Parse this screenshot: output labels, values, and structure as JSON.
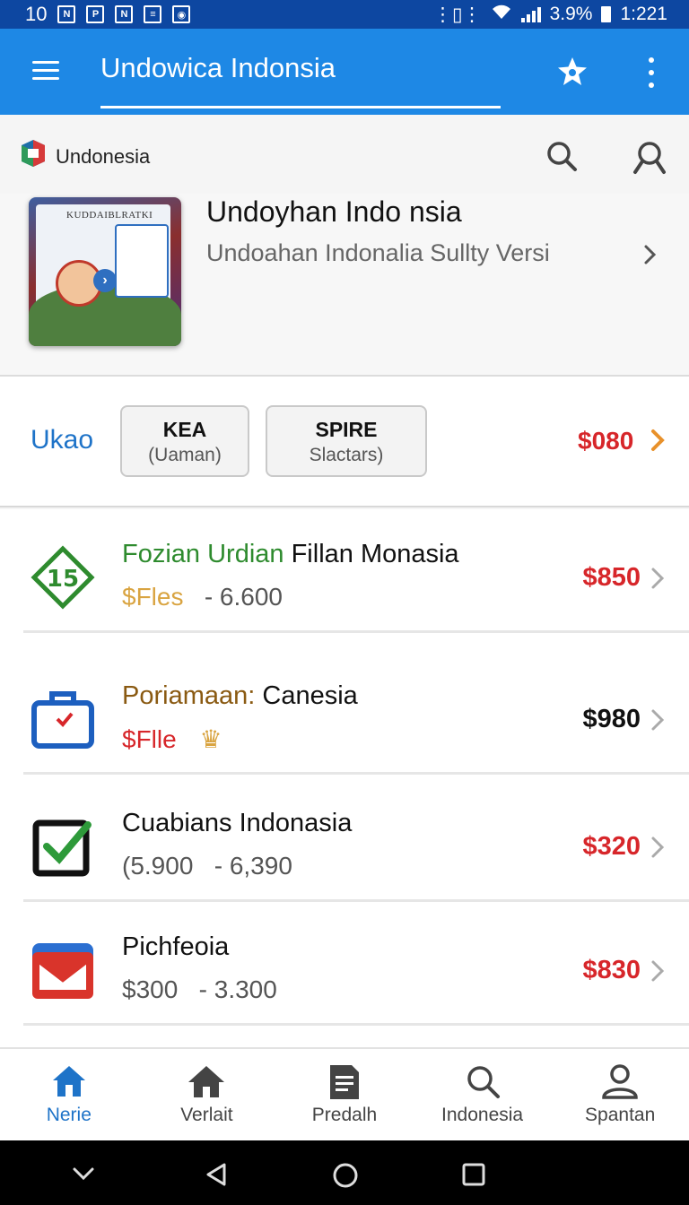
{
  "status_bar": {
    "time_left": "10",
    "battery": "3.9%",
    "clock": "1:221"
  },
  "app_bar": {
    "title": "Undowica Indonsia"
  },
  "brand": {
    "name": "Undonesia"
  },
  "featured": {
    "cover_text": "KUDDAIBLRATKI",
    "title": "Undoyhan Indo nsia",
    "subtitle": "Undoahan Indonalia Sullty Versi"
  },
  "filter": {
    "label": "Ukao",
    "chips": [
      {
        "title": "KEA",
        "sub": "(Uaman)"
      },
      {
        "title": "SPIRE",
        "sub": "Slactars)"
      }
    ],
    "price": "$080"
  },
  "list": [
    {
      "title_a": "Fozian Urdian",
      "title_b": "Fillan Monasia",
      "sub_a": "$Fles",
      "sub_b": "- 6.600",
      "price": "$850",
      "icon": "tag-icon"
    },
    {
      "title_a": "Poriamaan:",
      "title_b": "Canesia",
      "sub_a": "$Flle",
      "sub_b": "",
      "price": "$980",
      "icon": "briefcase-icon"
    },
    {
      "title_a": "",
      "title_b": "Cuabians Indonasia",
      "sub_a": "(5.900",
      "sub_b": "- 6,390",
      "price": "$320",
      "icon": "checkbox-icon"
    },
    {
      "title_a": "",
      "title_b": "Pichfeoia",
      "sub_a": "$300",
      "sub_b": "- 3.300",
      "price": "$830",
      "icon": "gmail-icon"
    }
  ],
  "bottom_nav": [
    {
      "label": "Nerie",
      "icon": "home-icon"
    },
    {
      "label": "Verlait",
      "icon": "house-icon"
    },
    {
      "label": "Predalh",
      "icon": "document-icon"
    },
    {
      "label": "Indonesia",
      "icon": "search-icon"
    },
    {
      "label": "Spantan",
      "icon": "user-icon"
    }
  ],
  "colors": {
    "app_bar": "#1e88e5",
    "status_bar": "#0d47a1",
    "price_red": "#d7262a",
    "accent_blue": "#1e73c8",
    "chevron_orange": "#e8912b"
  }
}
